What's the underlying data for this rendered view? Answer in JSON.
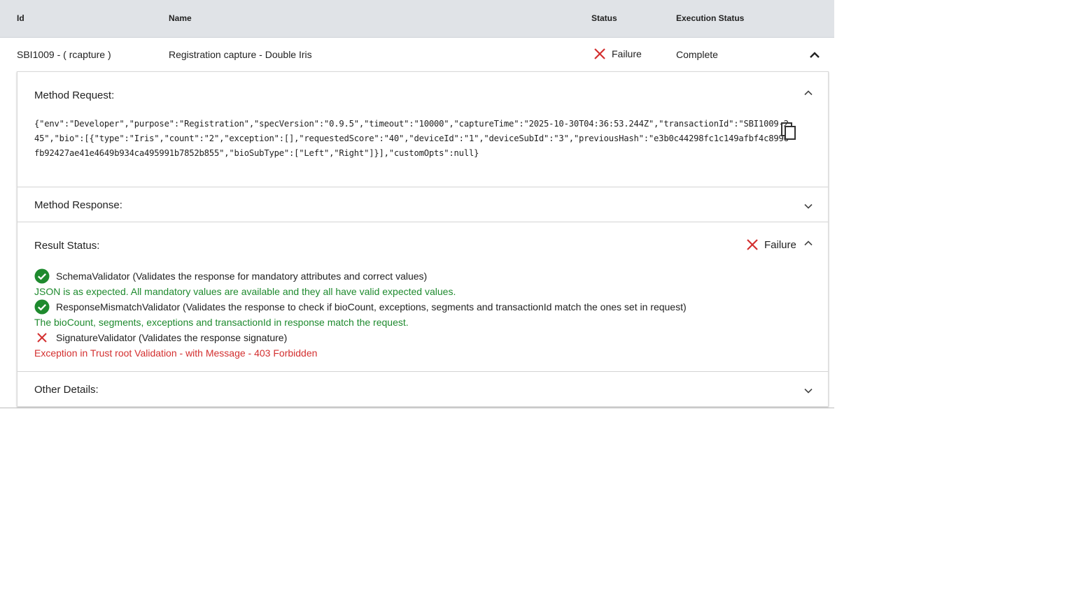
{
  "table": {
    "headers": {
      "id": "Id",
      "name": "Name",
      "status": "Status",
      "execution_status": "Execution Status"
    },
    "row": {
      "id": "SBI1009 - ( rcapture )",
      "name": "Registration capture - Double Iris",
      "status": "Failure",
      "status_icon": "close-icon",
      "execution_status": "Complete",
      "expanded": true
    }
  },
  "detail": {
    "method_request": {
      "title": "Method Request:",
      "expanded": true,
      "body": "{\"env\":\"Developer\",\"purpose\":\"Registration\",\"specVersion\":\"0.9.5\",\"timeout\":\"10000\",\"captureTime\":\"2025-10-30T04:36:53.244Z\",\"transactionId\":\"SBI1009-245\",\"bio\":[{\"type\":\"Iris\",\"count\":\"2\",\"exception\":[],\"requestedScore\":\"40\",\"deviceId\":\"1\",\"deviceSubId\":\"3\",\"previousHash\":\"e3b0c44298fc1c149afbf4c8996fb92427ae41e4649b934ca495991b7852b855\",\"bioSubType\":[\"Left\",\"Right\"]}],\"customOpts\":null}",
      "copy_icon": "copy-icon"
    },
    "method_response": {
      "title": "Method Response:",
      "expanded": false
    },
    "result_status": {
      "title": "Result Status:",
      "expanded": true,
      "status": "Failure",
      "validators": [
        {
          "name": "SchemaValidator (Validates the response for mandatory attributes and correct values)",
          "result": "pass",
          "icon": "check-circle-icon",
          "message": "JSON is as expected. All mandatory values are available and they all have valid expected values."
        },
        {
          "name": "ResponseMismatchValidator (Validates the response to check if bioCount, exceptions, segments and transactionId match the ones set in request)",
          "result": "pass",
          "icon": "check-circle-icon",
          "message": "The bioCount, segments, exceptions and transactionId in response match the request."
        },
        {
          "name": "SignatureValidator (Validates the response signature)",
          "result": "fail",
          "icon": "close-icon",
          "message": "Exception in Trust root Validation - with Message - 403 Forbidden"
        }
      ]
    },
    "other_details": {
      "title": "Other Details:",
      "expanded": false
    }
  },
  "colors": {
    "success": "#1e8a2e",
    "error": "#d32f2f",
    "header_bg": "#e0e3e7"
  }
}
